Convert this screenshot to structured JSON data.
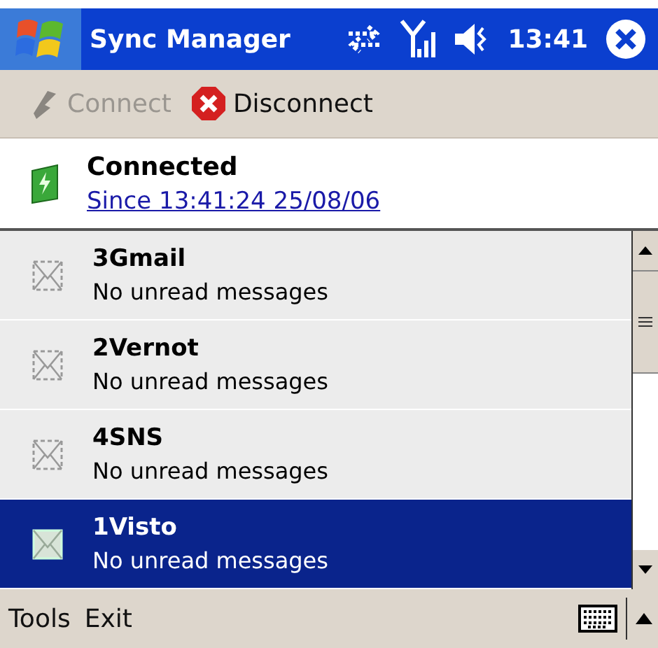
{
  "title_bar": {
    "title": "Sync Manager",
    "time": "13:41"
  },
  "toolbar": [
    {
      "label": "Connect",
      "kind": "connect",
      "disabled": true
    },
    {
      "label": "Disconnect",
      "kind": "disconnect",
      "disabled": false
    }
  ],
  "status": {
    "title": "Connected",
    "since": "Since 13:41:24 25/08/06"
  },
  "accounts": [
    {
      "name": "3Gmail",
      "detail": "No unread messages",
      "selected": false
    },
    {
      "name": "2Vernot",
      "detail": "No unread messages",
      "selected": false
    },
    {
      "name": "4SNS",
      "detail": "No unread messages",
      "selected": false
    },
    {
      "name": "1Visto",
      "detail": "No unread messages",
      "selected": true
    }
  ],
  "menu_bar": [
    "Tools",
    "Exit"
  ]
}
